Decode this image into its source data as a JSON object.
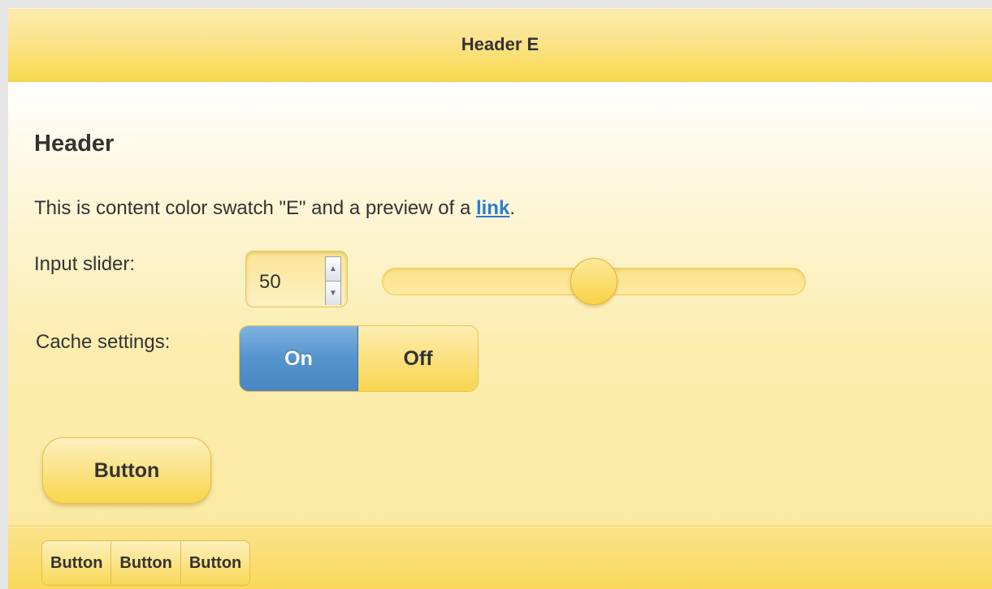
{
  "header": {
    "title": "Header E"
  },
  "content": {
    "heading": "Header",
    "text_before_link": "This is content color swatch \"E\" and a preview of a ",
    "link_text": "link",
    "text_after_link": "."
  },
  "slider": {
    "label": "Input slider:",
    "value": "50",
    "min": 0,
    "max": 100,
    "up_glyph": "▲",
    "down_glyph": "▼"
  },
  "toggle": {
    "label": "Cache settings:",
    "on_label": "On",
    "off_label": "Off",
    "state": "On"
  },
  "button": {
    "label": "Button"
  },
  "footer": {
    "buttons": [
      "Button",
      "Button",
      "Button"
    ]
  },
  "colors": {
    "swatch_yellow": "#f9d94d",
    "link_blue": "#2b7cd1",
    "toggle_active_blue": "#5593cc",
    "text": "#333333"
  }
}
